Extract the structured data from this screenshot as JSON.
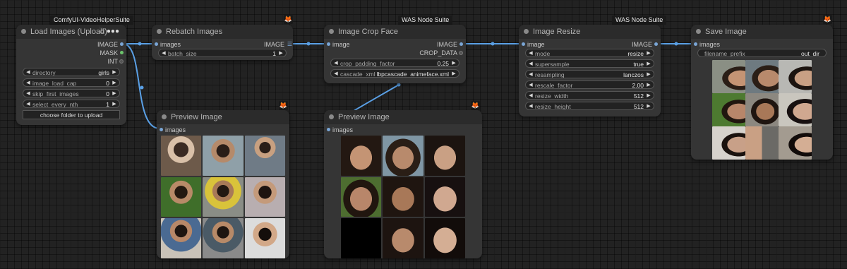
{
  "nodes": {
    "load_images": {
      "badge": "ComfyUI-VideoHelperSuite",
      "title": "Load Images (Upload)",
      "outputs": [
        "IMAGE",
        "MASK",
        "INT"
      ],
      "widgets": [
        {
          "label": "directory",
          "value": "girls"
        },
        {
          "label": "image_load_cap",
          "value": "0"
        },
        {
          "label": "skip_first_images",
          "value": "0"
        },
        {
          "label": "select_every_nth",
          "value": "1"
        }
      ],
      "button": "choose folder to upload"
    },
    "rebatch": {
      "title": "Rebatch Images",
      "input": "images",
      "output": "IMAGE",
      "widgets": [
        {
          "label": "batch_size",
          "value": "1"
        }
      ]
    },
    "preview1": {
      "title": "Preview Image",
      "input": "images"
    },
    "crop_face": {
      "badge": "WAS Node Suite",
      "title": "Image Crop Face",
      "input": "image",
      "outputs": [
        "IMAGE",
        "CROP_DATA"
      ],
      "widgets": [
        {
          "label": "crop_padding_factor",
          "value": "0.25"
        },
        {
          "label": "cascade_xml",
          "value": "lbpcascade_animeface.xml"
        }
      ]
    },
    "preview2": {
      "title": "Preview Image",
      "input": "images"
    },
    "resize": {
      "badge": "WAS Node Suite",
      "title": "Image Resize",
      "input": "image",
      "output": "IMAGE",
      "widgets": [
        {
          "label": "mode",
          "value": "resize"
        },
        {
          "label": "supersample",
          "value": "true"
        },
        {
          "label": "resampling",
          "value": "lanczos"
        },
        {
          "label": "rescale_factor",
          "value": "2.00"
        },
        {
          "label": "resize_width",
          "value": "512"
        },
        {
          "label": "resize_height",
          "value": "512"
        }
      ]
    },
    "save": {
      "title": "Save Image",
      "input": "images",
      "widgets": [
        {
          "label": "filename_prefix",
          "value": "out_dir"
        }
      ]
    }
  },
  "icons": {
    "node_badge": "fox-icon",
    "link_color": "#5aa0e6",
    "node_bg": "#353535",
    "title_bg": "#2b2b2b",
    "badge_text": "#e8e8e8",
    "fox_color": "#e8681f"
  }
}
